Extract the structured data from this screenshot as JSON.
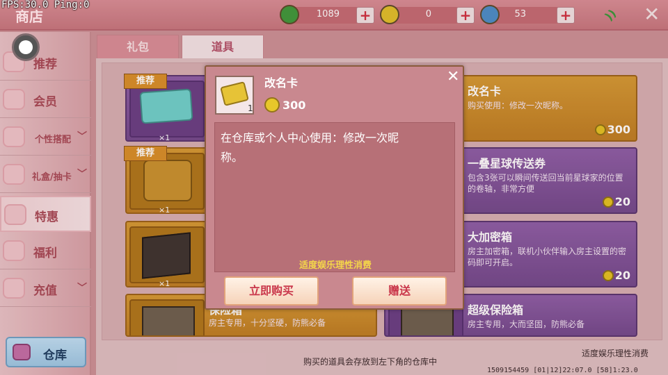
{
  "hud": {
    "fps": "FPS:30.0  Ping:0"
  },
  "header": {
    "title": "商店",
    "currencies": [
      {
        "icon": "green-gem-icon",
        "value": "1089",
        "color": "#3f9a3c"
      },
      {
        "icon": "gold-coin-icon",
        "value": "0",
        "color": "#e1c12b"
      },
      {
        "icon": "blue-coin-icon",
        "value": "53",
        "color": "#4b8fc9"
      }
    ],
    "plus_label": "+",
    "close_label": "✕",
    "signal_label": "))"
  },
  "sidebar": {
    "items": [
      {
        "label": "推荐",
        "has_chevron": false
      },
      {
        "label": "会员",
        "has_chevron": false
      },
      {
        "label": "个性搭配",
        "has_chevron": true
      },
      {
        "label": "礼盒/抽卡",
        "has_chevron": true
      },
      {
        "label": "特惠",
        "has_chevron": false
      },
      {
        "label": "福利",
        "has_chevron": false
      },
      {
        "label": "充值",
        "has_chevron": true
      }
    ],
    "chevron": "﹀",
    "warehouse_label": "仓库"
  },
  "tabs": [
    {
      "label": "礼包",
      "active": false
    },
    {
      "label": "道具",
      "active": true
    }
  ],
  "cards": {
    "left": [
      {
        "ribbon": "推荐",
        "qty": "×1"
      },
      {
        "ribbon": "推荐",
        "qty": "×1"
      },
      {
        "ribbon": "",
        "qty": "×1"
      },
      {
        "ribbon": "",
        "name": "保险箱",
        "desc": "房主专用，十分坚硬，防熊必备",
        "qty": ""
      }
    ],
    "right": [
      {
        "name": "改名卡",
        "desc": "购买使用：修改一次昵称。",
        "price": "300"
      },
      {
        "name": "一叠星球传送券",
        "desc": "包含3张可以瞬间传送回当前星球家的位置的卷轴，非常方便",
        "price": "20"
      },
      {
        "name": "大加密箱",
        "desc": "房主加密箱，联机小伙伴输入房主设置的密码即可开启。",
        "price": "20"
      },
      {
        "name": "超级保险箱",
        "desc": "房主专用，大而坚固，防熊必备",
        "price": ""
      }
    ]
  },
  "footer": {
    "note": "购买的道具会存放到左下角的仓库中",
    "right_note": "适度娱乐理性消费",
    "debug": "1509154459  [01|12]22:07.0  [58]1:23.0"
  },
  "modal": {
    "name": "改名卡",
    "thumb_qty": "1",
    "price": "300",
    "description": "在仓库或个人中心使用：修改一次昵称。",
    "note": "适度娱乐理性消费",
    "buy_label": "立即购买",
    "gift_label": "赠送",
    "close_label": "✕"
  }
}
